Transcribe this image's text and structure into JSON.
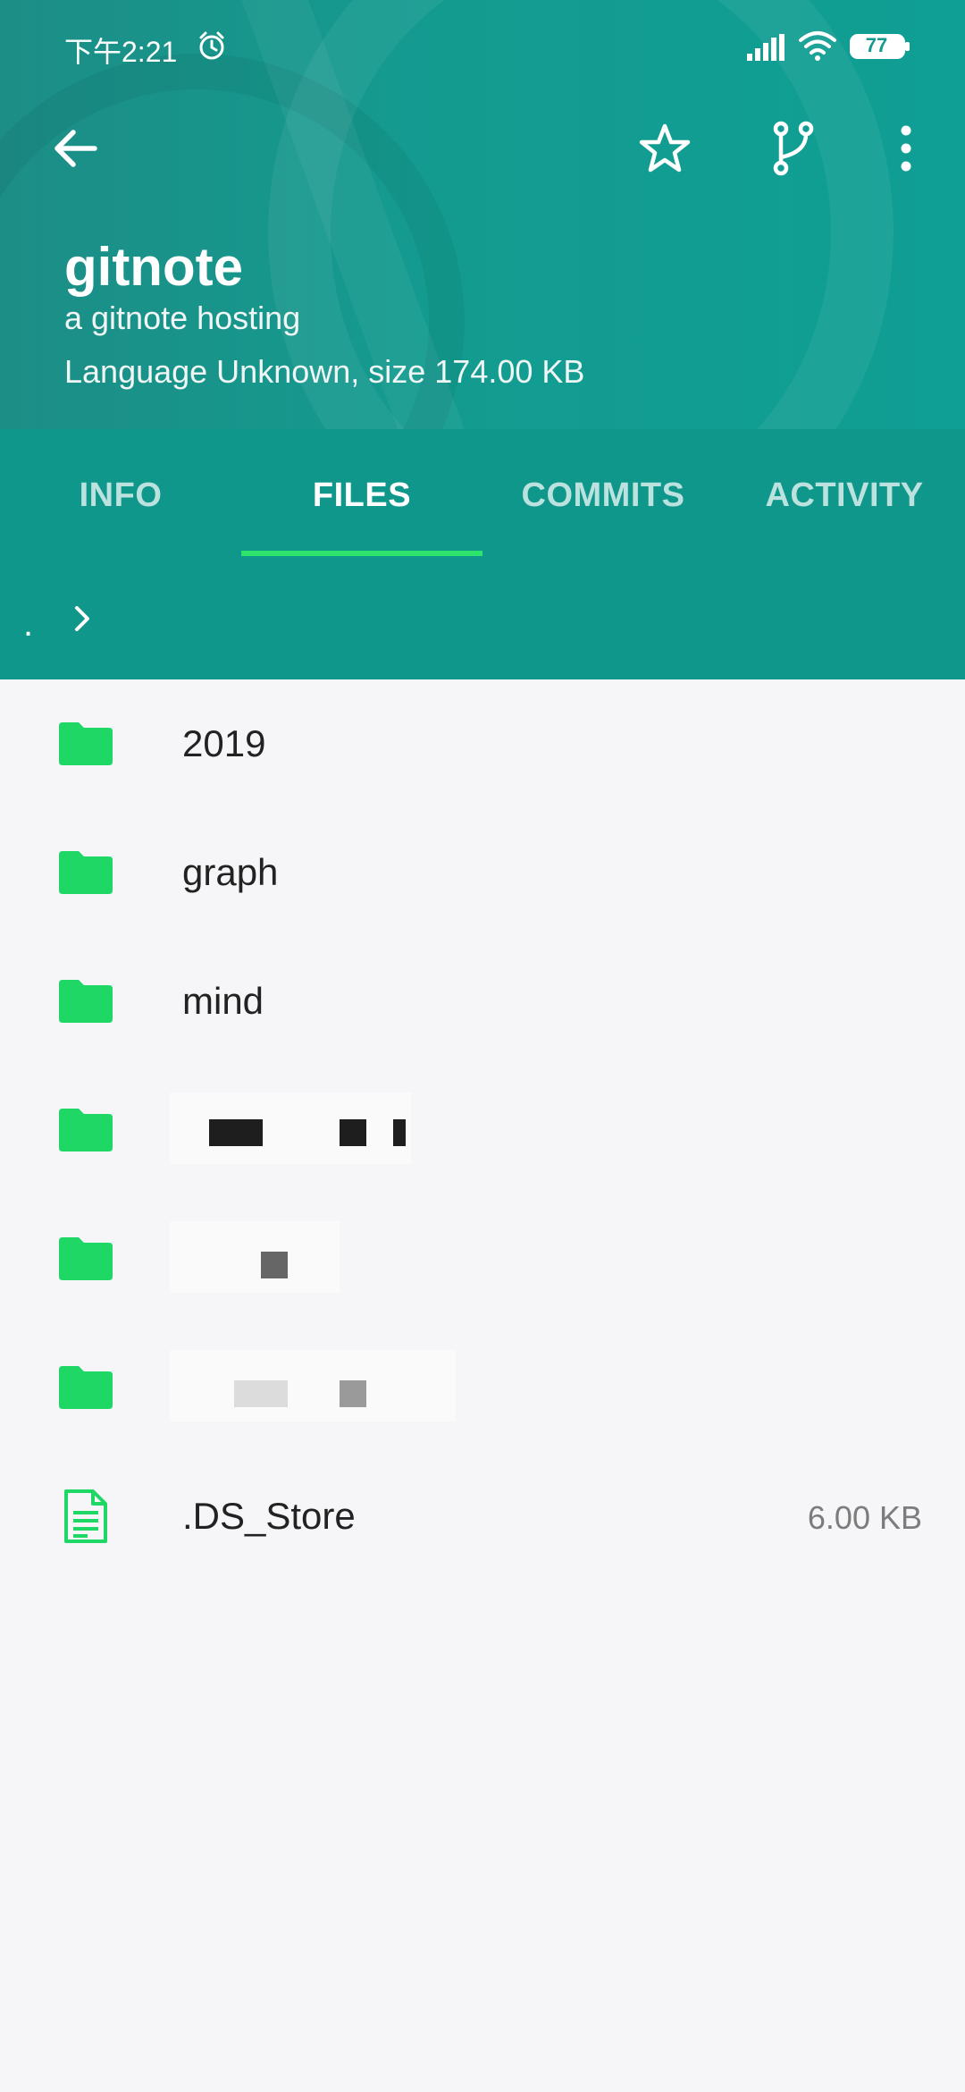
{
  "status_bar": {
    "time": "下午2:21",
    "battery": "77"
  },
  "icons": {
    "back": "arrow-left-icon",
    "star": "star-outline-icon",
    "branch": "git-branch-icon",
    "more": "more-vertical-icon",
    "folder": "folder-icon",
    "file": "file-document-icon"
  },
  "repo": {
    "title": "gitnote",
    "description": "a gitnote hosting",
    "meta": "Language Unknown, size 174.00 KB"
  },
  "tabs": [
    {
      "label": "INFO",
      "active": false
    },
    {
      "label": "FILES",
      "active": true
    },
    {
      "label": "COMMITS",
      "active": false
    },
    {
      "label": "ACTIVITY",
      "active": false
    }
  ],
  "path": {
    "root": "."
  },
  "files": [
    {
      "type": "folder",
      "name": "2019",
      "size": ""
    },
    {
      "type": "folder",
      "name": "graph",
      "size": ""
    },
    {
      "type": "folder",
      "name": "mind",
      "size": ""
    },
    {
      "type": "folder",
      "name": "",
      "size": ""
    },
    {
      "type": "folder",
      "name": "",
      "size": ""
    },
    {
      "type": "folder",
      "name": "",
      "size": ""
    },
    {
      "type": "file",
      "name": ".DS_Store",
      "size": "6.00 KB"
    }
  ],
  "colors": {
    "header": "#129a8e",
    "tab_indicator": "#2ee36a",
    "folder": "#1fd764",
    "background": "#f6f6f8"
  }
}
